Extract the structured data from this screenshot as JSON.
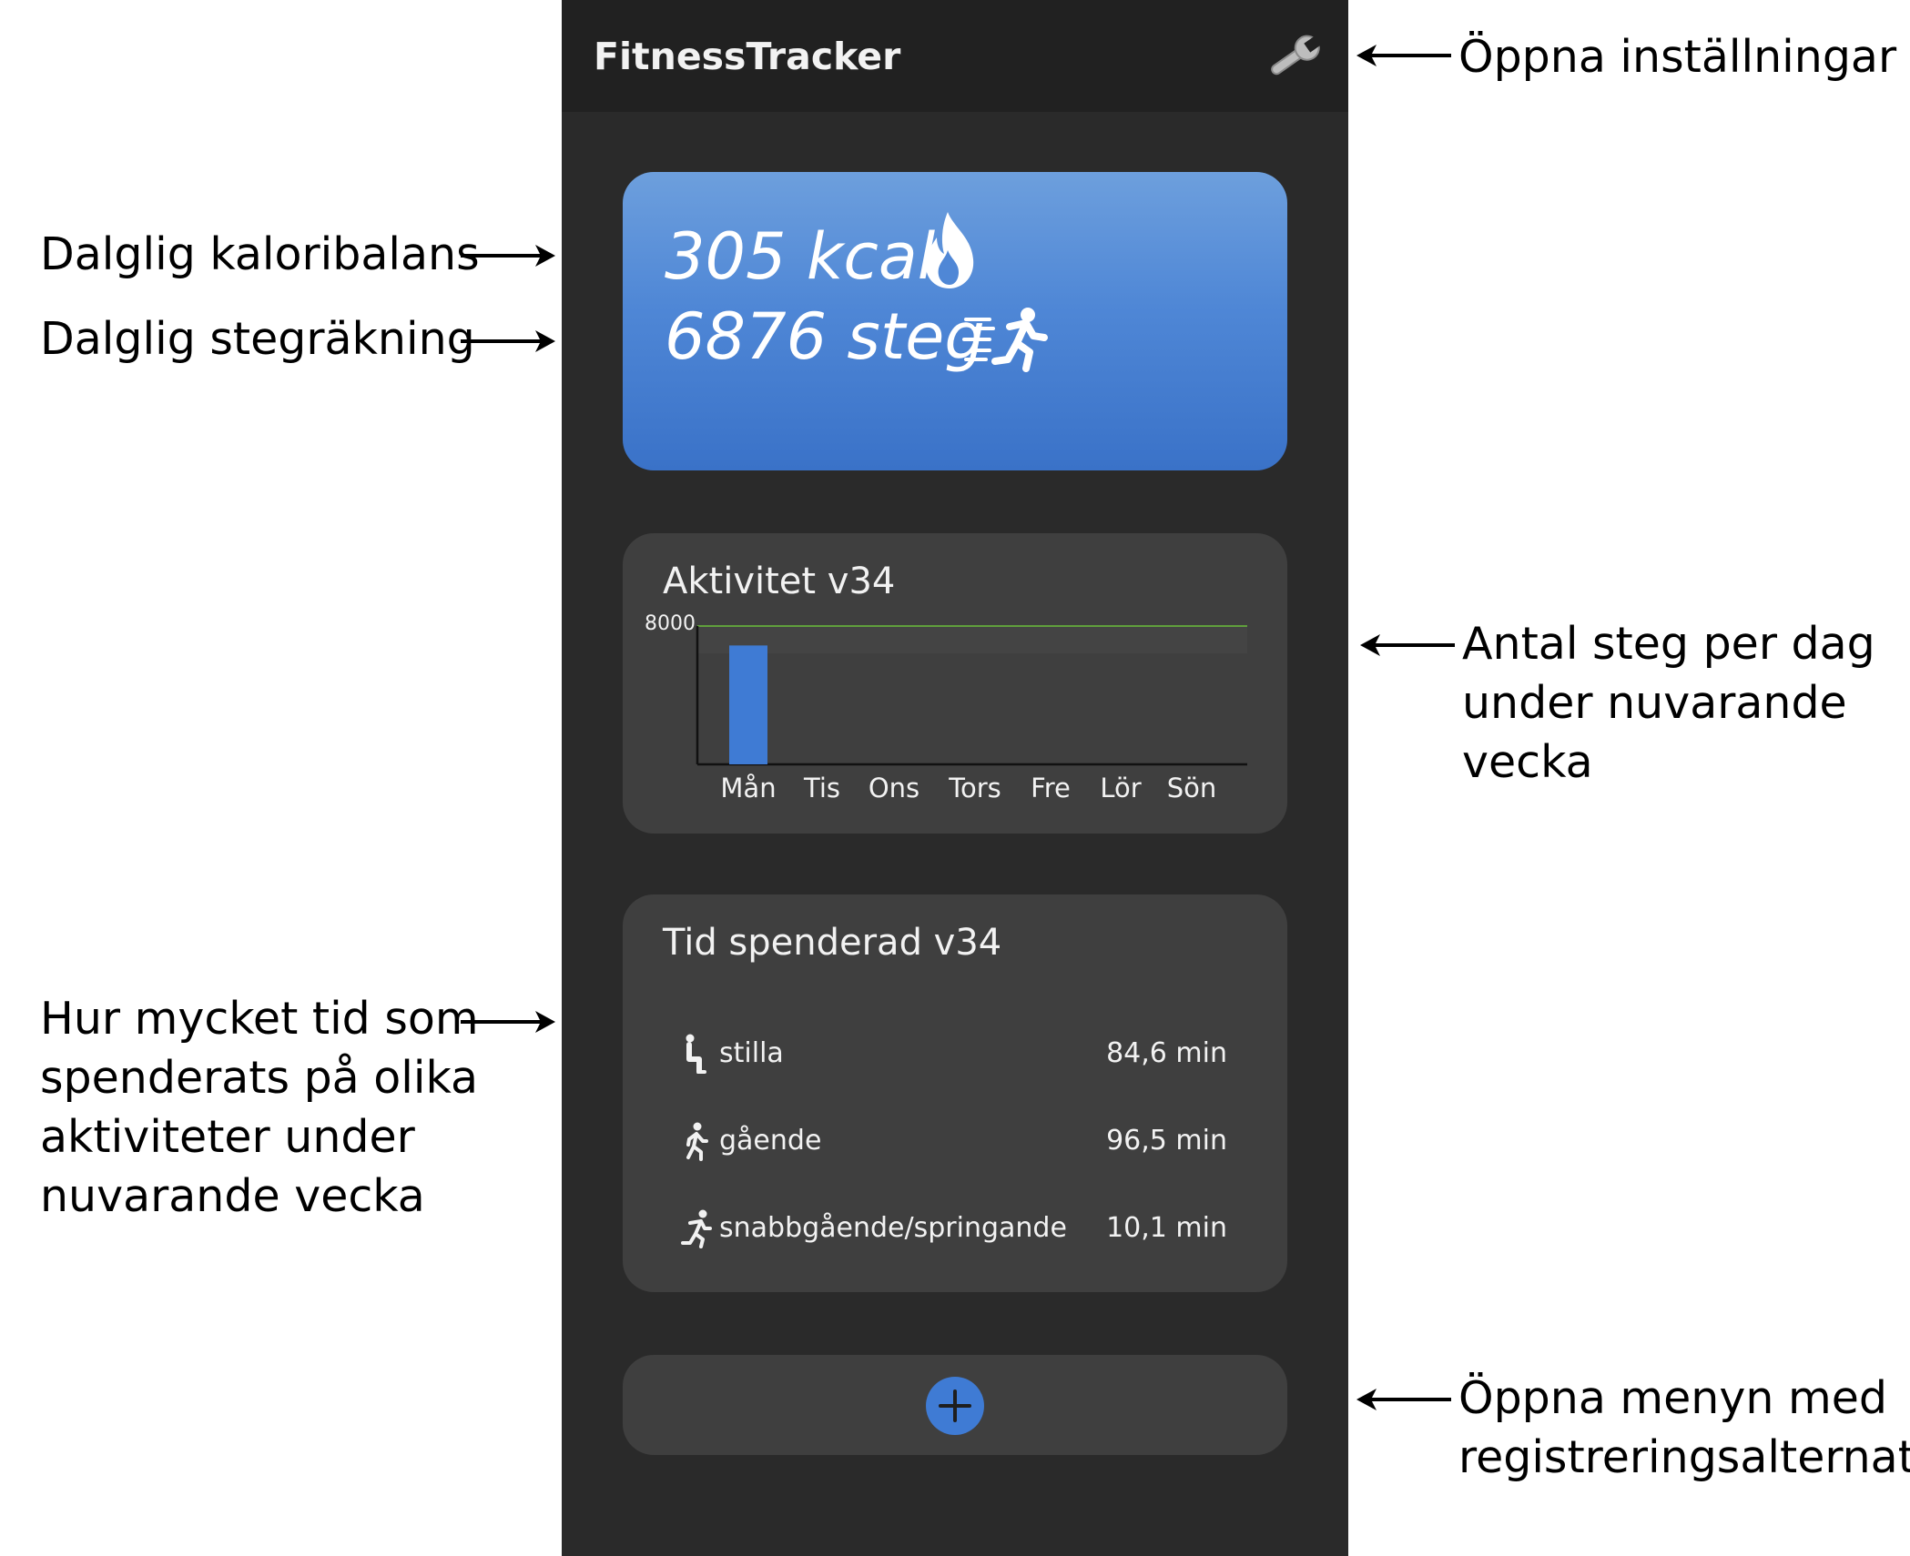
{
  "app": {
    "title": "FitnessTracker",
    "accent_color": "#3f7bd4",
    "goal_line_color": "#6abf3a",
    "settings_icon": "wrench-icon"
  },
  "summary": {
    "calories": "305 kcal",
    "calories_icon": "flame-icon",
    "steps": "6876 steg",
    "steps_icon": "running-icon"
  },
  "activity": {
    "title": "Aktivitet v34",
    "chart_data": {
      "type": "bar",
      "categories": [
        "Mån",
        "Tis",
        "Ons",
        "Tors",
        "Fre",
        "Lör",
        "Sön"
      ],
      "values": [
        6876,
        0,
        0,
        0,
        0,
        0,
        0
      ],
      "ytick_labels": [
        "8000"
      ],
      "goal_line": 8000,
      "ylim": [
        0,
        8000
      ],
      "bar_color": "#3f7bd4"
    }
  },
  "time_spent": {
    "title": "Tid spenderad v34",
    "rows": [
      {
        "icon": "sitting-icon",
        "label": "stilla",
        "value": "84,6 min"
      },
      {
        "icon": "walking-icon",
        "label": "gående",
        "value": "96,5 min"
      },
      {
        "icon": "running-icon",
        "label": "snabbgående/springande",
        "value": "10,1 min"
      }
    ]
  },
  "add_button": {
    "icon": "plus-icon"
  },
  "annotations": {
    "settings": "Öppna inställningar",
    "calories": "Dalglig kaloribalans",
    "steps": "Dalglig stegräkning",
    "chart": [
      "Antal steg per dag",
      "under nuvarande",
      "vecka"
    ],
    "time": [
      "Hur mycket tid som",
      "spenderats på olika",
      "aktiviteter under",
      "nuvarande vecka"
    ],
    "menu": [
      "Öppna menyn med",
      "registreringsalternativ"
    ]
  }
}
